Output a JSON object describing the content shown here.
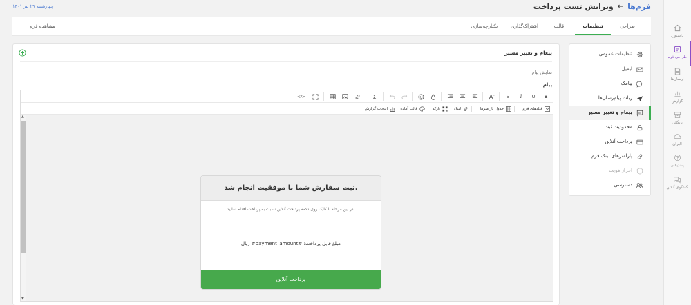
{
  "header": {
    "breadcrumb_root": "فرم‌ها",
    "page_title": "ویرایش تست پرداخت",
    "date": "چهارشنبه ۲۹ تیر ۱۴۰۱"
  },
  "rail": [
    {
      "label": "داشبورد",
      "icon": "home-icon"
    },
    {
      "label": "طراحی فرم",
      "icon": "design-icon"
    },
    {
      "label": "ارسال‌ها",
      "icon": "submissions-icon"
    },
    {
      "label": "گزارش",
      "icon": "report-icon"
    },
    {
      "label": "بایگانی",
      "icon": "archive-icon"
    },
    {
      "label": "الیران",
      "icon": "cloud-icon"
    },
    {
      "label": "پشتیبانی",
      "icon": "help-icon"
    },
    {
      "label": "گفتگوی آنلاین",
      "icon": "chat-icon"
    }
  ],
  "tabs": [
    "طراحی",
    "تنظیمات",
    "قالب",
    "اشتراک‌گذاری",
    "یکپارچه‌سازی"
  ],
  "preview_label": "مشاهده فرم",
  "menu": [
    {
      "label": "تنظیمات عمومی",
      "icon": "gear-icon"
    },
    {
      "label": "ایمیل",
      "icon": "mail-icon"
    },
    {
      "label": "پیامک",
      "icon": "sms-icon"
    },
    {
      "label": "ربات پیام‌رسان‌ها",
      "icon": "send-icon"
    },
    {
      "label": "پیغام و تغییر مسیر",
      "icon": "message-icon"
    },
    {
      "label": "محدودیت ثبت",
      "icon": "lock-icon"
    },
    {
      "label": "پرداخت آنلاین",
      "icon": "card-icon"
    },
    {
      "label": "پارامترهای لینک فرم",
      "icon": "link-icon"
    },
    {
      "label": "احراز هویت",
      "icon": "shield-icon"
    },
    {
      "label": "دسترسی",
      "icon": "users-icon"
    }
  ],
  "main": {
    "title": "پیغام و تغییر مسیر",
    "show_message": "نمایش پیام",
    "message_label": "پیام"
  },
  "toolbar2": {
    "form_fields": "فیلدهای فرم",
    "params_table": "جدول پارامترها",
    "link": "لینک",
    "barcode": "بارکد",
    "ready_template": "قالب آماده",
    "choose_report": "انتخاب گزارش"
  },
  "card": {
    "heading": "ثبت سفارش شما با موفقیت انجام شد.",
    "description": "در این مرحله با کلیک روی دکمه پرداخت آنلاین نسبت به پرداخت اقدام نمایید.",
    "amount": "مبلغ قابل پرداخت: #payment_amount# ریال",
    "button": "پرداخت آنلاین"
  },
  "colors": {
    "accent_green": "#3cae52",
    "link_blue": "#4d7bd1",
    "rail_active": "#8a4fc8",
    "button_green": "#47a94c"
  }
}
